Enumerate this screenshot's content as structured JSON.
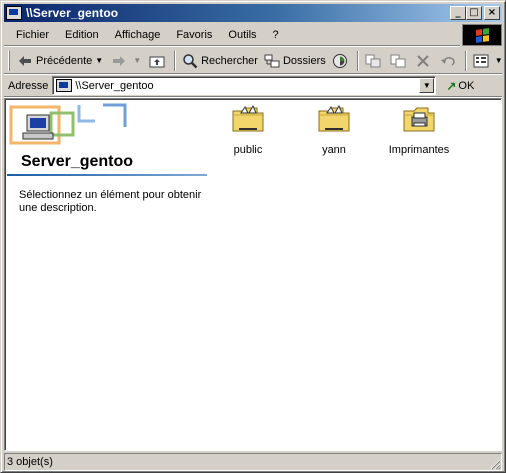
{
  "window": {
    "title": "\\\\Server_gentoo",
    "minimize_label": "_",
    "maximize_label": "□",
    "close_label": "×"
  },
  "menu": {
    "items": [
      "Fichier",
      "Edition",
      "Affichage",
      "Favoris",
      "Outils",
      "?"
    ]
  },
  "toolbar": {
    "back_label": "Précédente",
    "search_label": "Rechercher",
    "folders_label": "Dossiers"
  },
  "address": {
    "label": "Adresse",
    "value": "\\\\Server_gentoo",
    "go_label": "OK"
  },
  "panel": {
    "title": "Server_gentoo",
    "description": "Sélectionnez un élément pour obtenir une description."
  },
  "items": [
    {
      "label": "public",
      "icon": "shared-folder-icon"
    },
    {
      "label": "yann",
      "icon": "shared-folder-icon"
    },
    {
      "label": "Imprimantes",
      "icon": "printers-folder-icon"
    }
  ],
  "status": {
    "text": "3 objet(s)"
  },
  "colors": {
    "titlebar_start": "#0a246a",
    "titlebar_end": "#a6caf0",
    "face": "#d4d0c8",
    "folder": "#f2d66b"
  }
}
